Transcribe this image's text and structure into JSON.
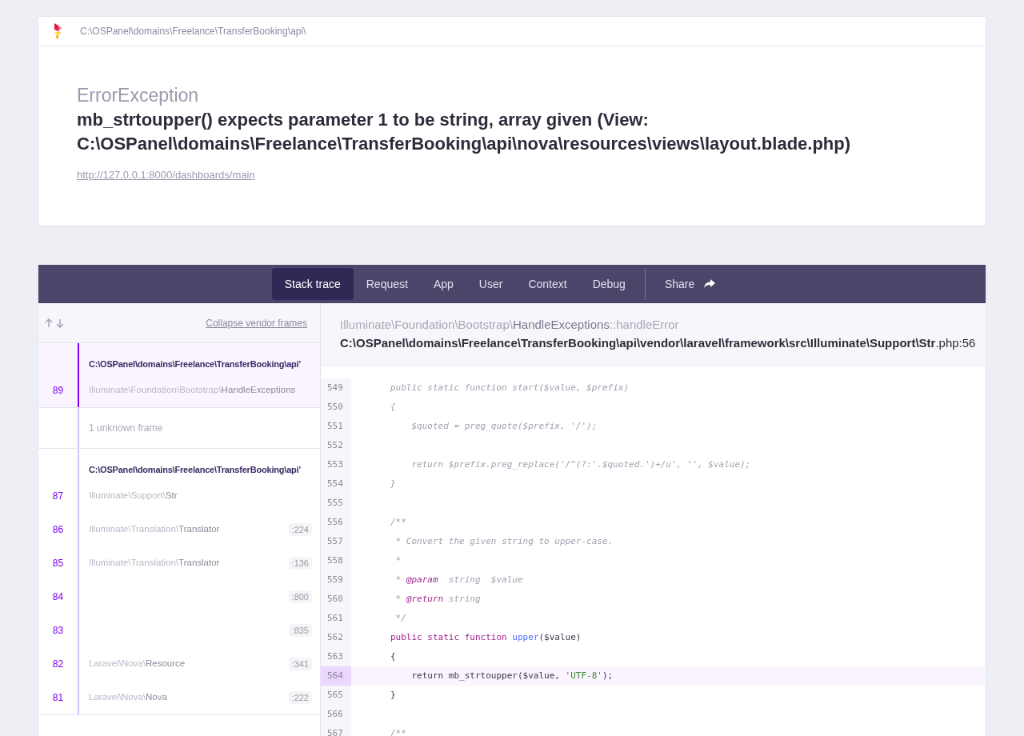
{
  "header": {
    "path": "C:\\OSPanel\\domains\\Freelance\\TransferBooking\\api\\"
  },
  "error": {
    "class": "ErrorException",
    "message": "mb_strtoupper() expects parameter 1 to be string, array given (View: C:\\OSPanel\\domains\\Freelance\\TransferBooking\\api\\nova\\resources\\views\\layout.blade.php)",
    "url": "http://127.0.0.1:8000/dashboards/main"
  },
  "tabs": [
    {
      "label": "Stack trace",
      "selected": true
    },
    {
      "label": "Request",
      "selected": false
    },
    {
      "label": "App",
      "selected": false
    },
    {
      "label": "User",
      "selected": false
    },
    {
      "label": "Context",
      "selected": false
    },
    {
      "label": "Debug",
      "selected": false
    }
  ],
  "share": {
    "label": "Share"
  },
  "frames_panel": {
    "collapse_link": "Collapse vendor frames",
    "groups": [
      {
        "kind": "file",
        "selected": true,
        "path": "C:\\OSPanel\\domains\\Freelance\\TransferBooking\\api'",
        "frames": [
          {
            "number": "89",
            "namespace": "Illuminate\\Foundation\\Bootstrap\\",
            "class": "HandleExceptions"
          }
        ]
      },
      {
        "kind": "unknown",
        "selected": false,
        "label": "1 unknown frame"
      },
      {
        "kind": "file",
        "selected": false,
        "path": "C:\\OSPanel\\domains\\Freelance\\TransferBooking\\api'",
        "frames": [
          {
            "number": "87",
            "namespace": "Illuminate\\Support\\",
            "class": "Str"
          },
          {
            "number": "86",
            "namespace": "Illuminate\\Translation\\",
            "class": "Translator",
            "line": ":224"
          },
          {
            "number": "85",
            "namespace": "Illuminate\\Translation\\",
            "class": "Translator",
            "line": ":136"
          },
          {
            "number": "84",
            "line": ":800"
          },
          {
            "number": "83",
            "line": ":835"
          },
          {
            "number": "82",
            "namespace": "Laravel\\Nova\\",
            "class": "Resource",
            "line": ":341"
          },
          {
            "number": "81",
            "namespace": "Laravel\\Nova\\",
            "class": "Nova",
            "line": ":222"
          }
        ]
      }
    ]
  },
  "code_panel": {
    "namespace": "Illuminate\\Foundation\\Bootstrap\\",
    "class": "HandleExceptions",
    "method": "::handleError",
    "file": "**C:\\OSPanel\\domains\\Freelance\\TransferBooking\\api\\vendor\\laravel\\framework\\src\\Illuminate\\Support\\Str**.php:56",
    "lines": [
      {
        "number": "549",
        "highlighted": false,
        "tokens": [
          {
            "kind": "muted",
            "t": "public static function start($value, $prefix)"
          }
        ]
      },
      {
        "number": "550",
        "highlighted": false,
        "tokens": [
          {
            "kind": "muted",
            "t": "{"
          }
        ]
      },
      {
        "number": "551",
        "highlighted": false,
        "tokens": [
          {
            "kind": "muted",
            "t": "    $quoted = preg_quote($prefix, '/');"
          }
        ]
      },
      {
        "number": "552",
        "highlighted": false
      },
      {
        "number": "553",
        "highlighted": false,
        "tokens": [
          {
            "kind": "muted",
            "t": "    return $prefix.preg_replace('/^(?:'.$quoted.')+/u', '', $value);"
          }
        ]
      },
      {
        "number": "554",
        "highlighted": false,
        "tokens": [
          {
            "kind": "muted",
            "t": "}"
          }
        ]
      },
      {
        "number": "555",
        "highlighted": false
      },
      {
        "number": "556",
        "highlighted": false,
        "tokens": [
          {
            "kind": "muted",
            "t": "/**"
          }
        ]
      },
      {
        "number": "557",
        "highlighted": false,
        "tokens": [
          {
            "kind": "muted",
            "t": " * Convert the given string to upper-case."
          }
        ]
      },
      {
        "number": "558",
        "highlighted": false,
        "tokens": [
          {
            "kind": "muted",
            "t": " *"
          }
        ]
      },
      {
        "number": "559",
        "highlighted": false,
        "tokens": [
          {
            "kind": "muted",
            "t": " * "
          },
          {
            "kind": "tag",
            "t": "@param"
          },
          {
            "kind": "muted",
            "t": "  string  $value"
          }
        ]
      },
      {
        "number": "560",
        "highlighted": false,
        "tokens": [
          {
            "kind": "muted",
            "t": " * "
          },
          {
            "kind": "tag",
            "t": "@return"
          },
          {
            "kind": "muted",
            "t": " string"
          }
        ]
      },
      {
        "number": "561",
        "highlighted": false,
        "tokens": [
          {
            "kind": "muted",
            "t": " */"
          }
        ]
      },
      {
        "number": "562",
        "highlighted": false,
        "tokens": [
          {
            "kind": "keyword",
            "t": "public static function "
          },
          {
            "kind": "fn",
            "t": "upper"
          },
          {
            "kind": "plain",
            "t": "($value)"
          }
        ]
      },
      {
        "number": "563",
        "highlighted": false,
        "tokens": [
          {
            "kind": "plain",
            "t": "{"
          }
        ]
      },
      {
        "number": "564",
        "highlighted": true,
        "tokens": [
          {
            "kind": "plain",
            "t": "    return mb_strtoupper($value, "
          },
          {
            "kind": "string",
            "t": "'UTF-8'"
          },
          {
            "kind": "plain",
            "t": ");"
          }
        ]
      },
      {
        "number": "565",
        "highlighted": false,
        "tokens": [
          {
            "kind": "plain",
            "t": "}"
          }
        ]
      },
      {
        "number": "566",
        "highlighted": false
      },
      {
        "number": "567",
        "highlighted": false,
        "tokens": [
          {
            "kind": "muted",
            "t": "/**"
          }
        ]
      }
    ]
  }
}
